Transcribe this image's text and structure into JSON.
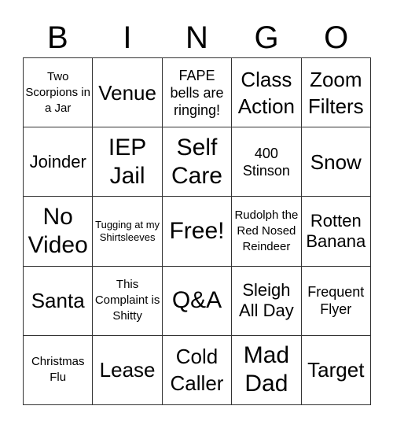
{
  "header": [
    "B",
    "I",
    "N",
    "G",
    "O"
  ],
  "cells": [
    {
      "text": "Two Scorpions in a Jar",
      "size": "s-xs"
    },
    {
      "text": "Venue",
      "size": "s-l"
    },
    {
      "text": "FAPE bells are ringing!",
      "size": "s-s"
    },
    {
      "text": "Class Action",
      "size": "s-l"
    },
    {
      "text": "Zoom Filters",
      "size": "s-l"
    },
    {
      "text": "Joinder",
      "size": "s-m"
    },
    {
      "text": "IEP Jail",
      "size": "s-xl"
    },
    {
      "text": "Self Care",
      "size": "s-xl"
    },
    {
      "text": "400 Stinson",
      "size": "s-s"
    },
    {
      "text": "Snow",
      "size": "s-l"
    },
    {
      "text": "No Video",
      "size": "s-xl"
    },
    {
      "text": "Tugging at my Shirtsleeves",
      "size": "s-xxs"
    },
    {
      "text": "Free!",
      "size": "s-xl"
    },
    {
      "text": "Rudolph the Red Nosed Reindeer",
      "size": "s-xs"
    },
    {
      "text": "Rotten Banana",
      "size": "s-m"
    },
    {
      "text": "Santa",
      "size": "s-l"
    },
    {
      "text": "This Complaint is Shitty",
      "size": "s-xs"
    },
    {
      "text": "Q&A",
      "size": "s-xl"
    },
    {
      "text": "Sleigh All Day",
      "size": "s-m"
    },
    {
      "text": "Frequent Flyer",
      "size": "s-s"
    },
    {
      "text": "Christmas Flu",
      "size": "s-xs"
    },
    {
      "text": "Lease",
      "size": "s-l"
    },
    {
      "text": "Cold Caller",
      "size": "s-l"
    },
    {
      "text": "Mad Dad",
      "size": "s-xl"
    },
    {
      "text": "Target",
      "size": "s-l"
    }
  ]
}
